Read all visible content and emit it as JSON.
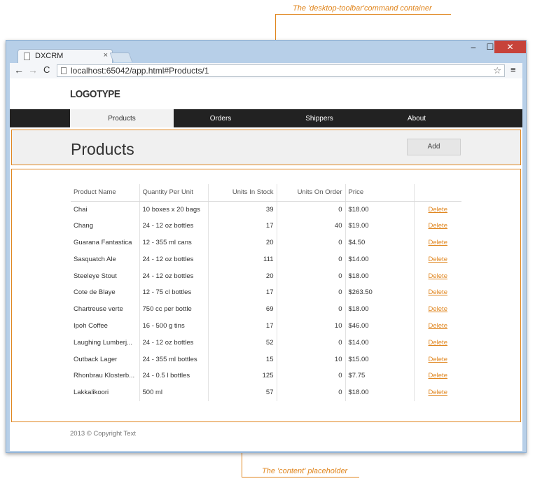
{
  "annotations": {
    "toolbar_caption": "The  'desktop-toolbar'command container",
    "content_caption": "The 'content' placeholder"
  },
  "browser": {
    "tab_title": "DXCRM",
    "tab_close": "×",
    "url": "localhost:65042/app.html#Products/1",
    "back_glyph": "←",
    "forward_glyph": "→",
    "reload_glyph": "C",
    "star_glyph": "☆",
    "menu_glyph": "≡",
    "min_glyph": "–",
    "max_glyph": "☐",
    "close_glyph": "✕"
  },
  "app": {
    "logo": "LOGOTYPE",
    "nav": [
      {
        "label": "Products",
        "active": true
      },
      {
        "label": "Orders",
        "active": false
      },
      {
        "label": "Shippers",
        "active": false
      },
      {
        "label": "About",
        "active": false
      }
    ],
    "page_title": "Products",
    "add_label": "Add",
    "columns": [
      "Product Name",
      "Quantity Per Unit",
      "Units In Stock",
      "Units On Order",
      "Price",
      ""
    ],
    "rows": [
      {
        "name": "Chai",
        "qty": "10 boxes x 20 bags",
        "stock": "39",
        "order": "0",
        "price": "$18.00",
        "action": "Delete"
      },
      {
        "name": "Chang",
        "qty": "24 - 12 oz bottles",
        "stock": "17",
        "order": "40",
        "price": "$19.00",
        "action": "Delete"
      },
      {
        "name": "Guarana Fantastica",
        "qty": "12 - 355 ml cans",
        "stock": "20",
        "order": "0",
        "price": "$4.50",
        "action": "Delete"
      },
      {
        "name": "Sasquatch Ale",
        "qty": "24 - 12 oz bottles",
        "stock": "111",
        "order": "0",
        "price": "$14.00",
        "action": "Delete"
      },
      {
        "name": "Steeleye Stout",
        "qty": "24 - 12 oz bottles",
        "stock": "20",
        "order": "0",
        "price": "$18.00",
        "action": "Delete"
      },
      {
        "name": "Cote de Blaye",
        "qty": "12 - 75 cl bottles",
        "stock": "17",
        "order": "0",
        "price": "$263.50",
        "action": "Delete"
      },
      {
        "name": "Chartreuse verte",
        "qty": "750 cc per bottle",
        "stock": "69",
        "order": "0",
        "price": "$18.00",
        "action": "Delete"
      },
      {
        "name": "Ipoh Coffee",
        "qty": "16 - 500 g tins",
        "stock": "17",
        "order": "10",
        "price": "$46.00",
        "action": "Delete"
      },
      {
        "name": "Laughing Lumberj...",
        "qty": "24 - 12 oz bottles",
        "stock": "52",
        "order": "0",
        "price": "$14.00",
        "action": "Delete"
      },
      {
        "name": "Outback Lager",
        "qty": "24 - 355 ml bottles",
        "stock": "15",
        "order": "10",
        "price": "$15.00",
        "action": "Delete"
      },
      {
        "name": "Rhonbrau Klosterb...",
        "qty": "24 - 0.5 l bottles",
        "stock": "125",
        "order": "0",
        "price": "$7.75",
        "action": "Delete"
      },
      {
        "name": "Lakkalikoori",
        "qty": "500 ml",
        "stock": "57",
        "order": "0",
        "price": "$18.00",
        "action": "Delete"
      }
    ],
    "footer": "2013 © Copyright Text"
  },
  "colors": {
    "accent": "#e0861f",
    "navbar": "#222222",
    "toolbar_bg": "#f0f0f0"
  }
}
